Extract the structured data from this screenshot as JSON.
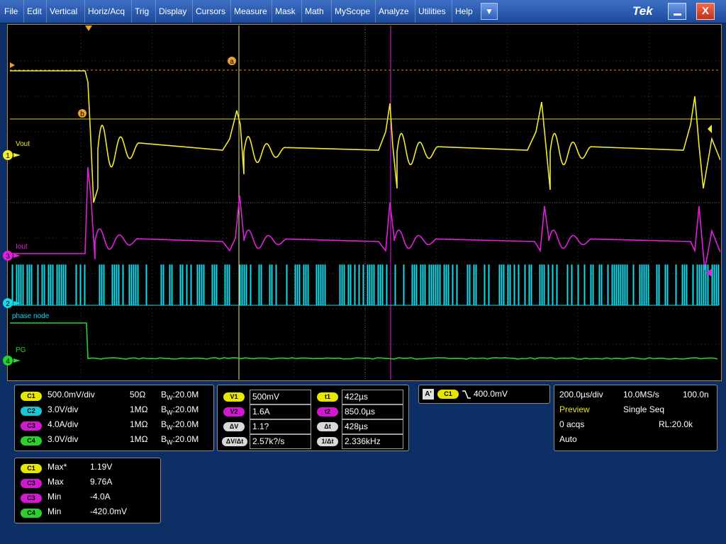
{
  "menu": {
    "items": [
      "File",
      "Edit",
      "Vertical",
      "Horiz/Acq",
      "Trig",
      "Display",
      "Cursors",
      "Measure",
      "Mask",
      "Math",
      "MyScope",
      "Analyze",
      "Utilities",
      "Help"
    ],
    "dropdown_icon": "▼",
    "logo": "Tek",
    "minimize_icon": "minimize-icon",
    "close_label": "X"
  },
  "graticule": {
    "colors": {
      "ch1": "#f2ea2c",
      "ch2": "#16d8e8",
      "ch3": "#e21fe0",
      "ch4": "#22d62a",
      "cursor_h": "#dfd600",
      "cursor_v1": "#f0e8a0",
      "cursor_v2": "#e21fe0",
      "frame": "#b28a33"
    },
    "cursor_labels": {
      "a": "a",
      "b": "b"
    },
    "channel_markers": [
      {
        "num": "1",
        "label": "Vout"
      },
      {
        "num": "3",
        "label": "Iout"
      },
      {
        "num": "2",
        "label": "phase node"
      },
      {
        "num": "4",
        "label": "PG"
      }
    ]
  },
  "channels": [
    {
      "badge": "C1",
      "scale": "500.0mV/div",
      "imp": "50Ω",
      "bw_prefix": "B",
      "bw_sub": "W",
      "bw_value": ":20.0M"
    },
    {
      "badge": "C2",
      "scale": "3.0V/div",
      "imp": "1MΩ",
      "bw_prefix": "B",
      "bw_sub": "W",
      "bw_value": ":20.0M"
    },
    {
      "badge": "C3",
      "scale": "4.0A/div",
      "imp": "1MΩ",
      "bw_prefix": "B",
      "bw_sub": "W",
      "bw_value": ":20.0M"
    },
    {
      "badge": "C4",
      "scale": "3.0V/div",
      "imp": "1MΩ",
      "bw_prefix": "B",
      "bw_sub": "W",
      "bw_value": ":20.0M"
    }
  ],
  "cursors": {
    "v1_label": "V1",
    "v1_value": "500mV",
    "v2_label": "V2",
    "v2_value": "1.6A",
    "dv_label": "ΔV",
    "dv_value": "1.1?",
    "dvdt_label": "ΔV/Δt",
    "dvdt_value": "2.57k?/s",
    "t1_label": "t1",
    "t1_value": "422µs",
    "t2_label": "t2",
    "t2_value": "850.0µs",
    "dt_label": "Δt",
    "dt_value": "428µs",
    "inv_dt_label": "1/Δt",
    "inv_dt_value": "2.336kHz"
  },
  "trigger": {
    "a_label": "A'",
    "source": "C1",
    "slope_icon": "falling-edge-icon",
    "level": "400.0mV"
  },
  "acquisition": {
    "timebase": "200.0µs/div",
    "sample_rate": "10.0MS/s",
    "resolution": "100.0n",
    "mode": "Preview",
    "run_mode": "Single Seq",
    "acqs": "0 acqs",
    "record_length": "RL:20.0k",
    "trigger_mode": "Auto"
  },
  "measurements": [
    {
      "badge": "C1",
      "name": "Max*",
      "value": "1.19V"
    },
    {
      "badge": "C3",
      "name": "Max",
      "value": "9.76A"
    },
    {
      "badge": "C3",
      "name": "Min",
      "value": "-4.0A"
    },
    {
      "badge": "C4",
      "name": "Min",
      "value": "-420.0mV"
    }
  ]
}
